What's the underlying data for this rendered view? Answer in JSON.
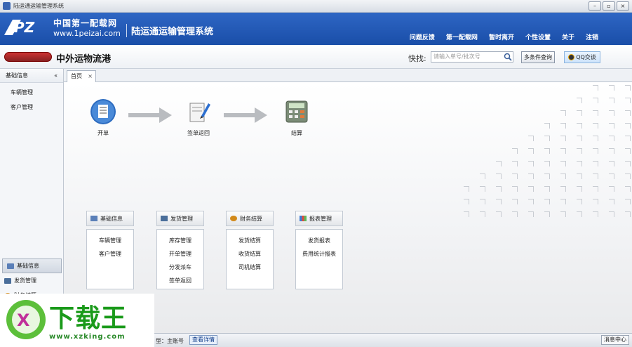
{
  "window": {
    "title": "陆运通运输管理系统",
    "buttons": [
      "–",
      "▫",
      "×"
    ]
  },
  "header": {
    "logo_cn": "中国第一配载网",
    "logo_url": "www.1peizai.com",
    "system_title": "陆运通运输管理系统",
    "nav": [
      "问题反馈",
      "第一配载网",
      "暂时离开",
      "个性设置",
      "关于",
      "注销"
    ]
  },
  "subheader": {
    "company": "中外运物流港",
    "quick_label": "快找:",
    "quick_placeholder": "请输入单号/批次号",
    "advanced_query": "多条件查询",
    "qq_chat": "QQ交谈"
  },
  "sidebar": {
    "title": "基础信息",
    "collapse": "«",
    "items": [
      "车辆管理",
      "客户管理"
    ],
    "groups": [
      "基础信息",
      "发货管理",
      "财务结算"
    ]
  },
  "tabs": [
    {
      "label": "首页",
      "close": "×"
    }
  ],
  "flow": [
    {
      "label": "开单",
      "icon": "document-icon"
    },
    {
      "label": "签单返回",
      "icon": "sign-icon"
    },
    {
      "label": "结算",
      "icon": "calculator-icon"
    }
  ],
  "modules": [
    {
      "title": "基础信息",
      "icon": "info-icon",
      "links": [
        "车辆管理",
        "客户管理"
      ]
    },
    {
      "title": "发货管理",
      "icon": "truck-icon",
      "links": [
        "库存管理",
        "开单管理",
        "分发派车",
        "签单返回"
      ]
    },
    {
      "title": "财务结算",
      "icon": "money-icon",
      "links": [
        "发货结算",
        "收货结算",
        "司机结算"
      ]
    },
    {
      "title": "报表管理",
      "icon": "chart-icon",
      "links": [
        "发货报表",
        "费用统计报表"
      ]
    }
  ],
  "statusbar": {
    "account_type": "型：主账号",
    "view_detail": "查看详情",
    "message_center": "消息中心"
  },
  "watermark": {
    "brand": "下载王",
    "url": "www.xzking.com"
  },
  "colors": {
    "header_blue": "#1f56b3",
    "watermark_green": "#1a9a1a"
  }
}
